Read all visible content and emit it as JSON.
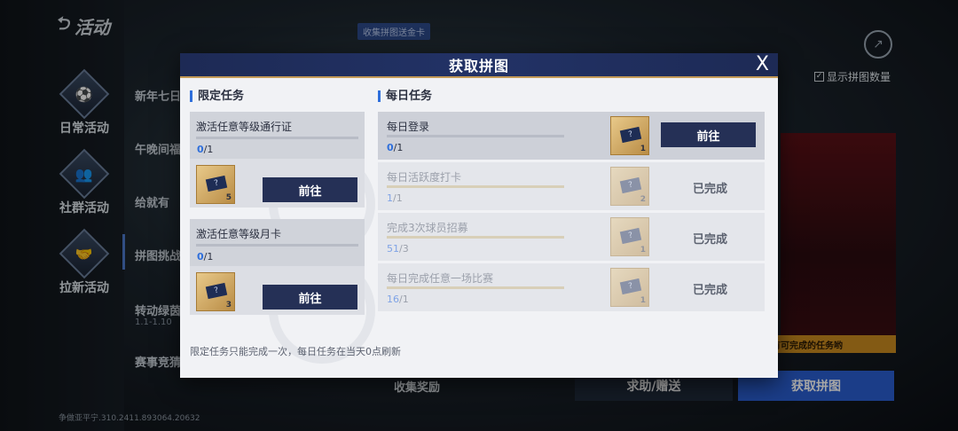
{
  "background": {
    "back_title": "活动",
    "categories": [
      {
        "label": "日常活动",
        "icon": "soccer-ball-icon"
      },
      {
        "label": "社群活动",
        "icon": "group-icon"
      },
      {
        "label": "拉新活动",
        "icon": "handshake-icon"
      }
    ],
    "side_items": [
      {
        "label": "新年七日"
      },
      {
        "label": "午晚间福"
      },
      {
        "label": "给就有"
      },
      {
        "label": "拼图挑战"
      },
      {
        "label": "转动绿茵"
      },
      {
        "label": "赛事竞猜"
      }
    ],
    "side_sub": "1.1-1.10",
    "top_tag": "收集拼图送金卡",
    "show_count_label": "显示拼图数量",
    "show_count_checked": true,
    "hint_banner": "有可完成的任务哟",
    "collect_reward_label": "收集奖励",
    "help_button": "求助/赠送",
    "get_button": "获取拼图",
    "version": "争做亚平宁.310.2411.893064.20632"
  },
  "modal": {
    "title": "获取拼图",
    "close_symbol": "X",
    "limited": {
      "section_title": "限定任务",
      "tasks": [
        {
          "name": "激活任意等级通行证",
          "current": "0",
          "total": "/1",
          "reward_symbol": "?",
          "reward_count": "5",
          "button": "前往"
        },
        {
          "name": "激活任意等级月卡",
          "current": "0",
          "total": "/1",
          "reward_symbol": "?",
          "reward_count": "3",
          "button": "前往"
        }
      ]
    },
    "daily": {
      "section_title": "每日任务",
      "tasks": [
        {
          "name": "每日登录",
          "current": "0",
          "total": "/1",
          "reward_symbol": "?",
          "reward_count": "1",
          "button": "前往",
          "status": "active"
        },
        {
          "name": "每日活跃度打卡",
          "current": "1",
          "total": "/1",
          "reward_symbol": "?",
          "reward_count": "2",
          "status_label": "已完成",
          "status": "done"
        },
        {
          "name": "完成3次球员招募",
          "current": "51",
          "total": "/3",
          "reward_symbol": "?",
          "reward_count": "1",
          "status_label": "已完成",
          "status": "done"
        },
        {
          "name": "每日完成任意一场比赛",
          "current": "16",
          "total": "/1",
          "reward_symbol": "?",
          "reward_count": "1",
          "status_label": "已完成",
          "status": "done"
        }
      ]
    },
    "footnote": "限定任务只能完成一次，每日任务在当天0点刷新"
  },
  "colors": {
    "header_navy": "#1d2a55",
    "accent_blue": "#2f6fdb",
    "button_navy": "#253056",
    "gold": "#c49a57",
    "primary_blue": "#2a5ed1"
  }
}
